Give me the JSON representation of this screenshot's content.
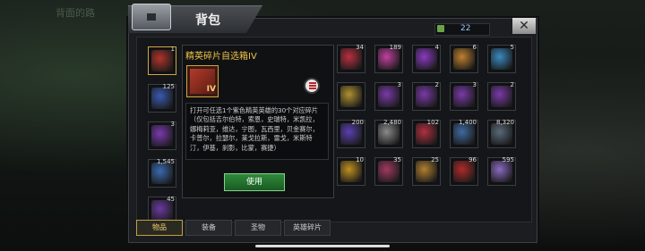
{
  "background": {
    "faint_text": "背面的路"
  },
  "header": {
    "title": "背包",
    "counter_value": "22",
    "close_label": "✕"
  },
  "detail": {
    "title": "精英碎片自选箱IV",
    "badge": "IV",
    "description": "打开可任选1个紫色精英英雄的30个对应碎片（仅包括吉尔伯特，索恩，史瑞特，米凯拉，娜梅莉亚，维达，宁图，瓦西里，贝金赛尔，卡普尔，拉瑟尔，莱戈拉斯，雷戈，米斯特汀，伊基，刹影，比蒙，赛捷）",
    "use_label": "使用"
  },
  "left_column": [
    {
      "count": "1",
      "color": "#b0342a"
    },
    {
      "count": "125",
      "color": "#3a5ab0"
    },
    {
      "count": "3",
      "color": "#7a3ab0"
    },
    {
      "count": "1,545",
      "color": "#3a6ab0"
    },
    {
      "count": "45",
      "color": "#6a3aa0"
    }
  ],
  "grid_items": [
    {
      "count": "34",
      "color": "#b83040"
    },
    {
      "count": "189",
      "color": "#c040a0"
    },
    {
      "count": "4",
      "color": "#8a3ac0"
    },
    {
      "count": "6",
      "color": "#c08030"
    },
    {
      "count": "5",
      "color": "#3a8ac0"
    },
    {
      "count": "",
      "color": "#b09030"
    },
    {
      "count": "3",
      "color": "#7a3aa8"
    },
    {
      "count": "2",
      "color": "#7a3aa8"
    },
    {
      "count": "3",
      "color": "#7a3aa8"
    },
    {
      "count": "2",
      "color": "#7a3aa8"
    },
    {
      "count": "200",
      "color": "#5a40b0"
    },
    {
      "count": "2,480",
      "color": "#8a8a8a"
    },
    {
      "count": "102",
      "color": "#b03040"
    },
    {
      "count": "1,400",
      "color": "#406aa0"
    },
    {
      "count": "8,320",
      "color": "#5a6a7a"
    },
    {
      "count": "10",
      "color": "#c09020"
    },
    {
      "count": "35",
      "color": "#a03a60"
    },
    {
      "count": "25",
      "color": "#b08030"
    },
    {
      "count": "96",
      "color": "#b02a2a"
    },
    {
      "count": "595",
      "color": "#8a6ac0"
    }
  ],
  "tabs": [
    {
      "label": "物品",
      "active": true
    },
    {
      "label": "装备",
      "active": false
    },
    {
      "label": "圣物",
      "active": false
    },
    {
      "label": "英雄碎片",
      "active": false
    }
  ]
}
